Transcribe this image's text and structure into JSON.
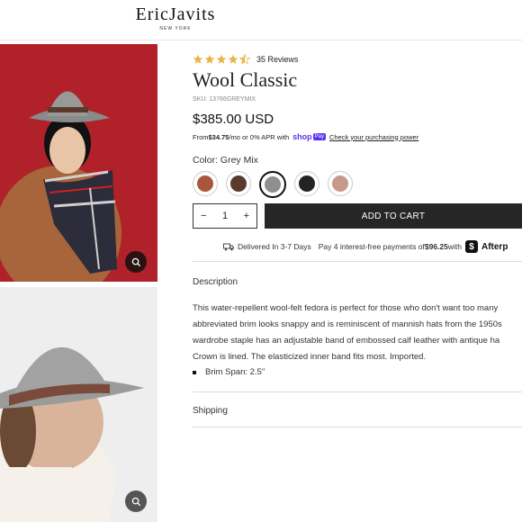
{
  "header": {
    "logo_main": "EricJavits",
    "logo_sub": "NEW YORK"
  },
  "product": {
    "review_count": "35 Reviews",
    "rating": 4.5,
    "title": "Wool Classic",
    "sku": "SKU: 13766GREYMIX",
    "price": "$385.00 USD"
  },
  "financing": {
    "prefix": "From ",
    "amount": "$34.75",
    "middle": "/mo or 0% APR with ",
    "shop": "shop",
    "pay": "Pay",
    "link": "Check your purchasing power"
  },
  "color": {
    "label": "Color: Grey Mix",
    "swatches": [
      {
        "name": "Rust",
        "color": "#a9563b",
        "selected": false
      },
      {
        "name": "Brown",
        "color": "#5a3a2c",
        "selected": false
      },
      {
        "name": "Grey Mix",
        "color": "#8f8f8f",
        "selected": true
      },
      {
        "name": "Black",
        "color": "#232323",
        "selected": false
      },
      {
        "name": "Blush",
        "color": "#c69a88",
        "selected": false
      }
    ]
  },
  "cart": {
    "quantity": "1",
    "minus": "−",
    "plus": "+",
    "add_label": "ADD TO CART"
  },
  "delivery": {
    "text": "Delivered In 3-7 Days",
    "afterpay_prefix": "Pay 4 interest-free payments of ",
    "afterpay_amount": "$96.25",
    "afterpay_with": " with ",
    "afterpay_brand": "Afterp"
  },
  "description": {
    "heading": "Description",
    "lines": [
      "This water-repellent wool-felt fedora is perfect for those who don't want too many",
      "abbreviated brim looks snappy and is reminiscent of mannish hats from the 1950s",
      "wardrobe staple has an adjustable band of embossed calf leather with antique ha",
      "Crown is lined. The elasticized inner band fits most. Imported."
    ],
    "bullet": "Brim Span: 2.5\""
  },
  "shipping": {
    "heading": "Shipping"
  },
  "colors": {
    "accent": "#262626",
    "shop_purple": "#5a31f4",
    "star": "#e7b54a",
    "photo1_bg": "#b0212a"
  }
}
